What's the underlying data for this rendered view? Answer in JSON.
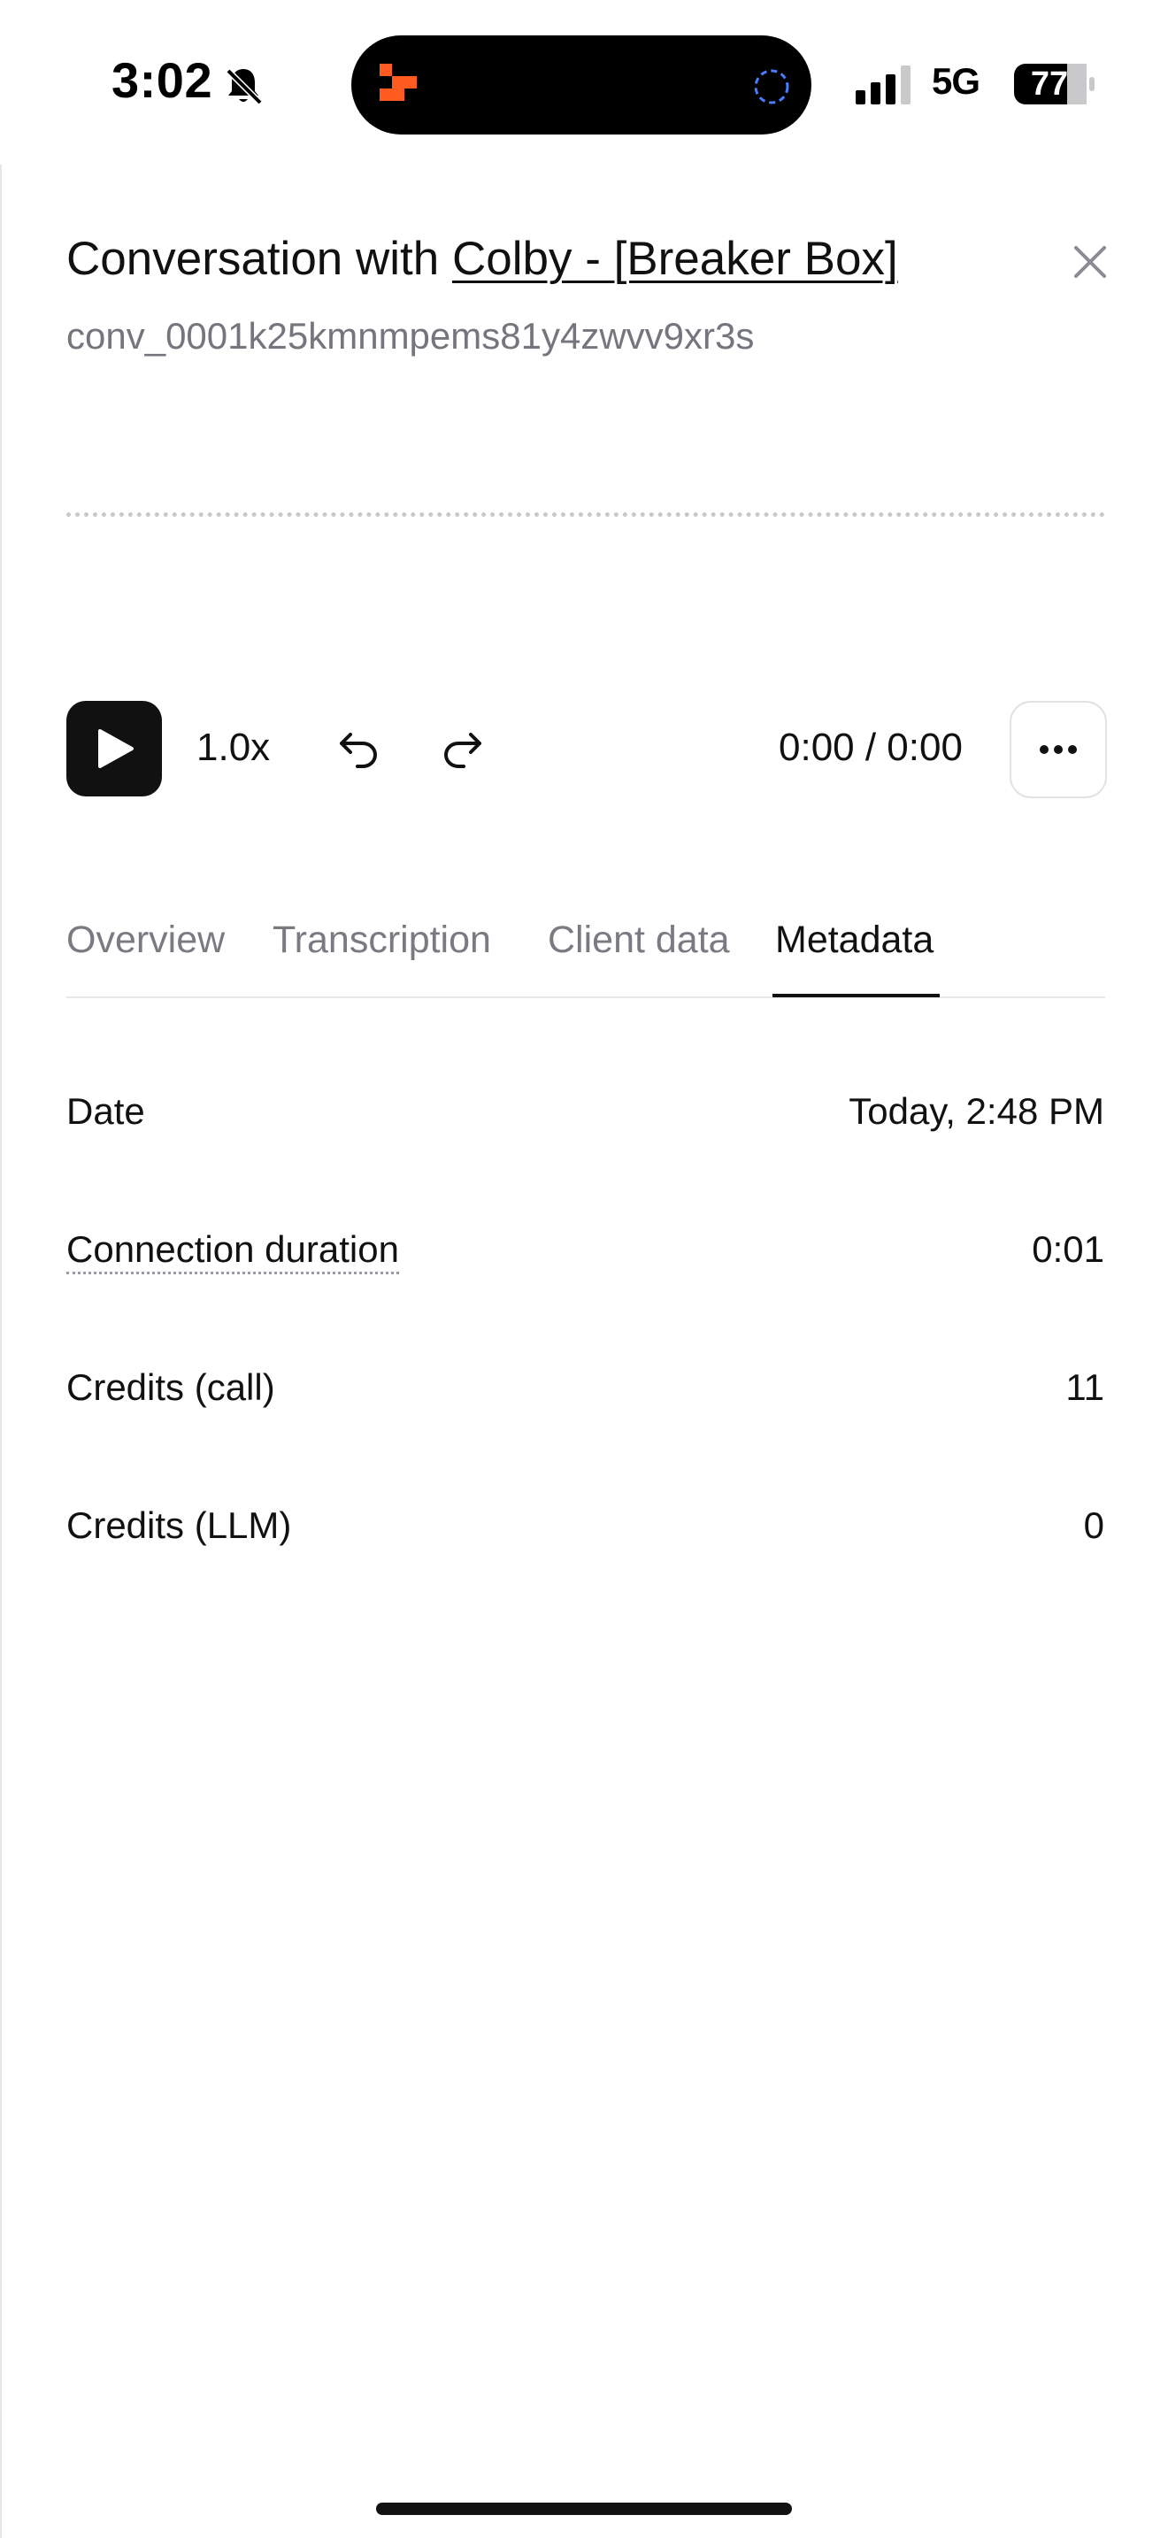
{
  "status_bar": {
    "time": "3:02",
    "network": "5G",
    "battery": "77",
    "icons": [
      "bell-slash-icon",
      "app-logo-icon",
      "activity-ring-icon",
      "signal-icon",
      "battery-icon"
    ]
  },
  "header": {
    "title_prefix": "Conversation with ",
    "agent_name": "Colby - [Breaker Box]",
    "conversation_id": "conv_0001k25kmnmpems81y4zwvv9xr3s"
  },
  "player": {
    "speed": "1.0x",
    "time_display": "0:00 / 0:00"
  },
  "tabs": [
    {
      "label": "Overview",
      "active": false
    },
    {
      "label": "Transcription",
      "active": false
    },
    {
      "label": "Client data",
      "active": false
    },
    {
      "label": "Metadata",
      "active": true
    }
  ],
  "metadata": [
    {
      "label": "Date",
      "value": "Today, 2:48 PM"
    },
    {
      "label": "Connection duration",
      "value": "0:01"
    },
    {
      "label": "Credits (call)",
      "value": "11"
    },
    {
      "label": "Credits (LLM)",
      "value": "0"
    }
  ],
  "colors": {
    "accent": "#111111",
    "muted_text": "#75757d",
    "logo_orange": "#ff5a1f",
    "ring_blue": "#4a7dff"
  }
}
